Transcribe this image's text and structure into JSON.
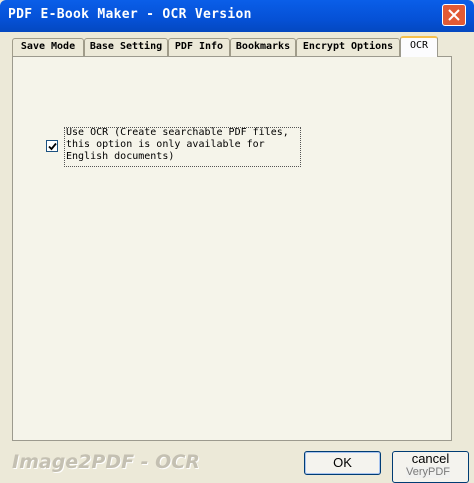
{
  "window": {
    "title": "PDF E-Book Maker - OCR Version",
    "close_label": "X"
  },
  "tabs": [
    {
      "label": "Save Mode",
      "active": false
    },
    {
      "label": "Base Setting",
      "active": false
    },
    {
      "label": "PDF Info",
      "active": false
    },
    {
      "label": "Bookmarks",
      "active": false
    },
    {
      "label": "Encrypt Options",
      "active": false
    },
    {
      "label": "OCR",
      "active": true
    }
  ],
  "ocr_panel": {
    "use_ocr_checked": true,
    "use_ocr_label": "Use OCR (Create searchable PDF files, this option is only available for English documents)"
  },
  "footer": {
    "brand": "Image2PDF - OCR",
    "ok_label": "OK",
    "cancel_label": "cancel",
    "watermark": "VeryPDF"
  },
  "colors": {
    "titlebar": "#0551d6",
    "window_bg": "#ece9d8",
    "close_button": "#e15a35",
    "active_tab_highlight": "#f7c04c"
  }
}
